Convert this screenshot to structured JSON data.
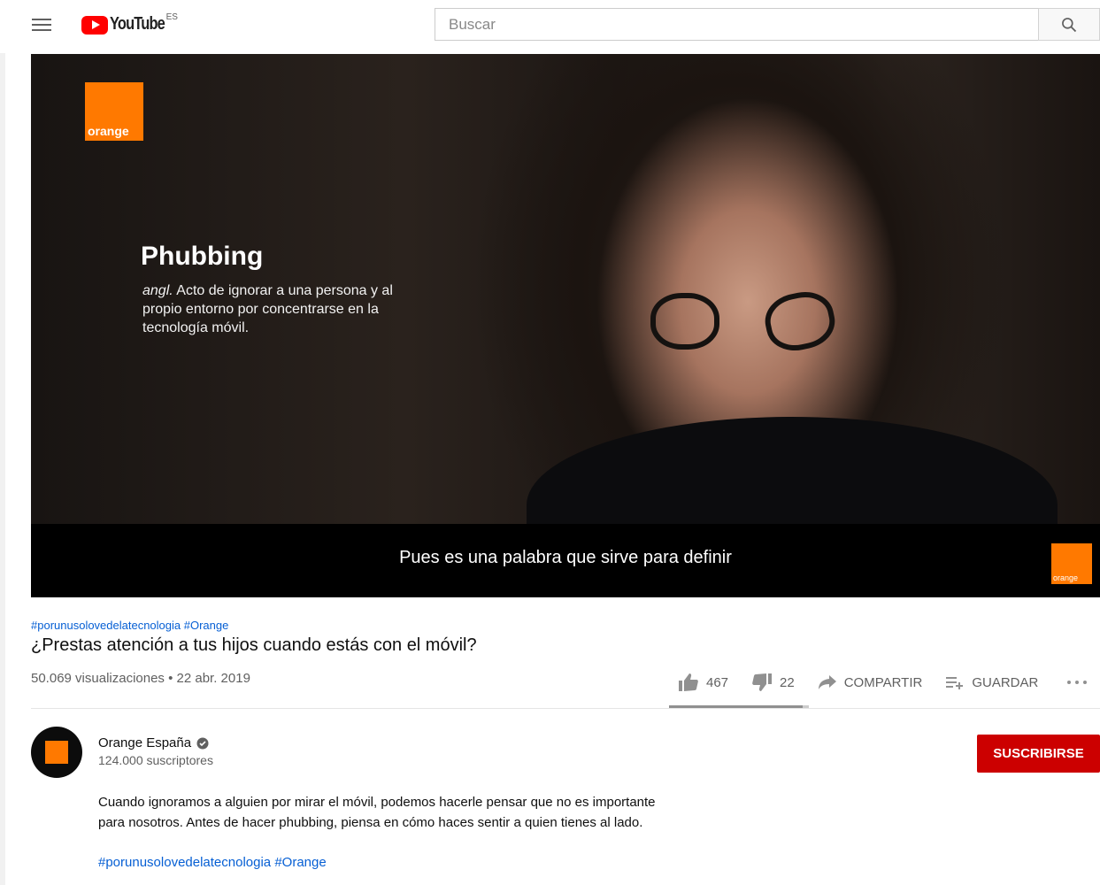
{
  "header": {
    "logo_text": "YouTube",
    "country_code": "ES",
    "search_placeholder": "Buscar"
  },
  "video": {
    "overlay_title": "Phubbing",
    "overlay_def_prefix": "angl.",
    "overlay_def_text": " Acto de ignorar a una persona y al propio entorno por concentrarse en la tecnología móvil.",
    "brand_text": "orange",
    "caption": "Pues es una palabra que sirve para definir"
  },
  "info": {
    "hashtags": "#porunusolovedelatecnologia #Orange",
    "title": "¿Prestas atención a tus hijos cuando estás con el móvil?",
    "meta": "50.069 visualizaciones • 22 abr. 2019",
    "likes": "467",
    "dislikes": "22",
    "share_label": "COMPARTIR",
    "save_label": "GUARDAR",
    "like_ratio": 0.955
  },
  "channel": {
    "name": "Orange España",
    "subscribers": "124.000 suscriptores",
    "subscribe_label": "SUSCRIBIRSE"
  },
  "description": {
    "line1": "Cuando ignoramos a alguien por mirar el móvil, podemos hacerle pensar que no es importante",
    "line2": "para nosotros. Antes de hacer phubbing, piensa en cómo haces sentir a quien tienes al lado.",
    "hashtags": "#porunusolovedelatecnologia #Orange"
  },
  "colors": {
    "brand_red": "#ff0000",
    "orange": "#ff7900",
    "link": "#065fd4",
    "subscribe": "#cc0000"
  }
}
